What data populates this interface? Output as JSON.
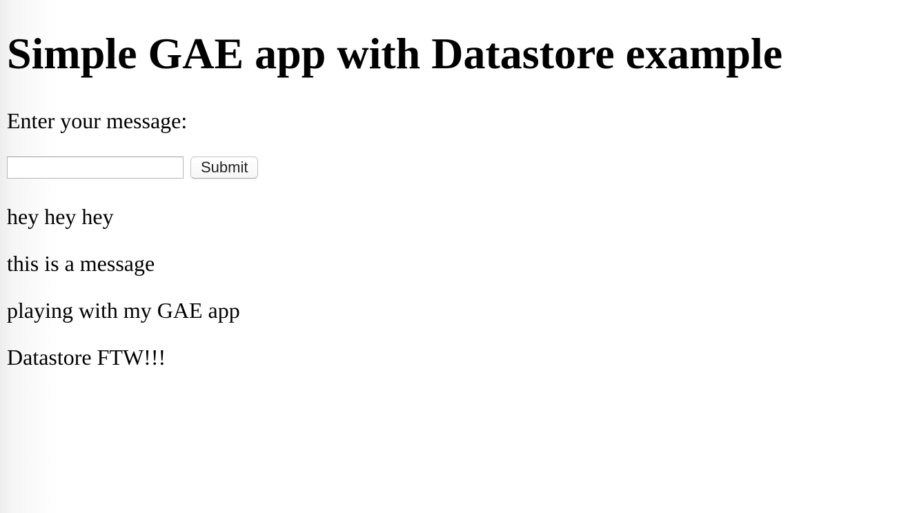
{
  "page": {
    "heading": "Simple GAE app with Datastore example",
    "prompt": "Enter your message:"
  },
  "form": {
    "input_value": "",
    "input_placeholder": "",
    "submit_label": "Submit"
  },
  "messages": [
    "hey hey hey",
    "this is a message",
    "playing with my GAE app",
    "Datastore FTW!!!"
  ]
}
